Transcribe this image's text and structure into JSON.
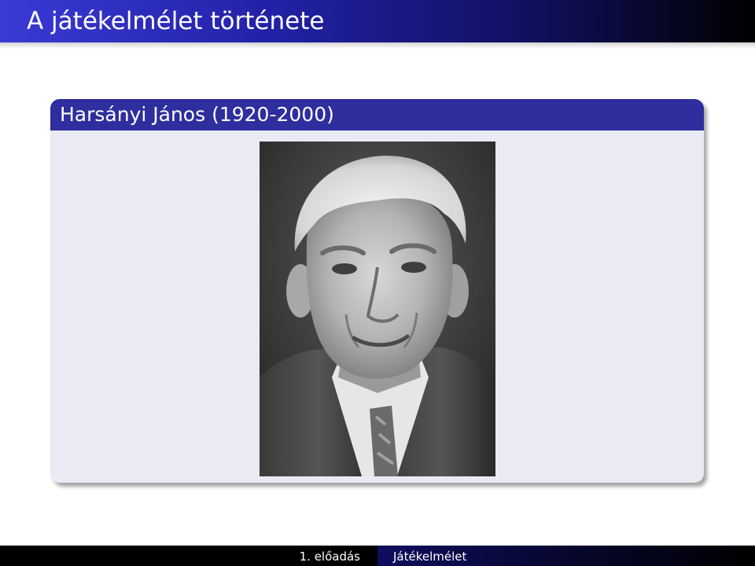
{
  "frame": {
    "title": "A játékelmélet története"
  },
  "block": {
    "title": "Harsányi János (1920-2000)"
  },
  "footer": {
    "left_text": "1. előadás",
    "right_text": "Játékelmélet"
  },
  "colors": {
    "title_bar_start": "#3a3ad6",
    "title_bar_end": "#000000",
    "block_header": "#2e2e9e",
    "block_body": "#eaeaf4",
    "footer_left": "#000000",
    "footer_right": "#0e0e5e"
  },
  "image": {
    "kind": "black-and-white portrait photograph"
  }
}
